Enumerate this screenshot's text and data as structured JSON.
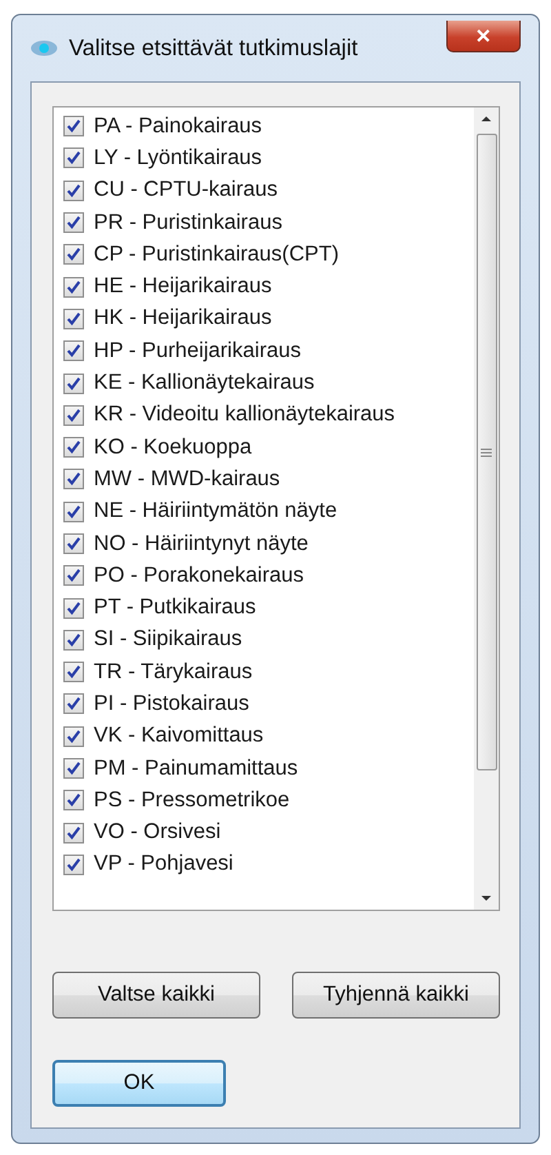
{
  "window": {
    "title": "Valitse etsittävät tutkimuslajit",
    "close_glyph": "✕"
  },
  "items": [
    {
      "label": "PA - Painokairaus",
      "checked": true
    },
    {
      "label": "LY - Lyöntikairaus",
      "checked": true
    },
    {
      "label": "CU - CPTU-kairaus",
      "checked": true
    },
    {
      "label": "PR - Puristinkairaus",
      "checked": true
    },
    {
      "label": "CP - Puristinkairaus(CPT)",
      "checked": true
    },
    {
      "label": "HE - Heijarikairaus",
      "checked": true
    },
    {
      "label": "HK - Heijarikairaus",
      "checked": true
    },
    {
      "label": "HP - Purheijarikairaus",
      "checked": true
    },
    {
      "label": "KE - Kallionäytekairaus",
      "checked": true
    },
    {
      "label": "KR - Videoitu kallionäytekairaus",
      "checked": true
    },
    {
      "label": "KO - Koekuoppa",
      "checked": true
    },
    {
      "label": "MW - MWD-kairaus",
      "checked": true
    },
    {
      "label": "NE - Häiriintymätön näyte",
      "checked": true
    },
    {
      "label": "NO - Häiriintynyt näyte",
      "checked": true
    },
    {
      "label": "PO - Porakonekairaus",
      "checked": true
    },
    {
      "label": "PT - Putkikairaus",
      "checked": true
    },
    {
      "label": "SI - Siipikairaus",
      "checked": true
    },
    {
      "label": "TR - Tärykairaus",
      "checked": true
    },
    {
      "label": "PI - Pistokairaus",
      "checked": true
    },
    {
      "label": "VK - Kaivomittaus",
      "checked": true
    },
    {
      "label": "PM - Painumamittaus",
      "checked": true
    },
    {
      "label": "PS - Pressometrikoe",
      "checked": true
    },
    {
      "label": "VO - Orsivesi",
      "checked": true
    },
    {
      "label": "VP - Pohjavesi",
      "checked": true
    }
  ],
  "buttons": [
    {
      "label": "Valtse kaikki",
      "default": false
    },
    {
      "label": "Tyhjennä kaikki",
      "default": false
    },
    {
      "label": "OK",
      "default": true
    }
  ]
}
